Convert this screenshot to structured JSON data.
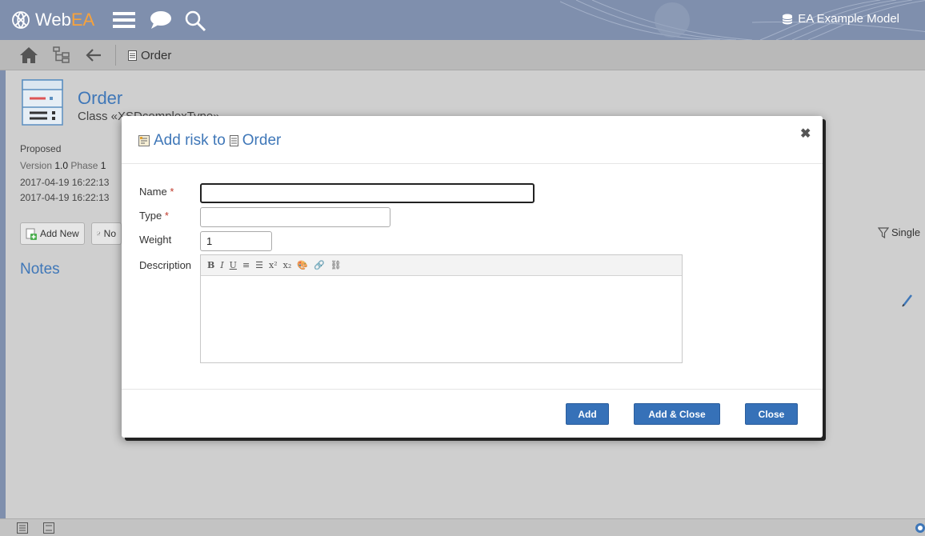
{
  "app": {
    "brand_web": "Web",
    "brand_ea": "EA",
    "model_name": "EA Example Model"
  },
  "nav": {
    "breadcrumb": "Order"
  },
  "element": {
    "title": "Order",
    "subtitle": "Class «XSDcomplexType»",
    "status": "Proposed",
    "version_label": "Version",
    "version_value": "1.0",
    "phase_label": "Phase",
    "phase_value": "1",
    "created": "2017-04-19 16:22:13",
    "modified": "2017-04-19 16:22:13"
  },
  "toolbar": {
    "add_new_label": "Add New",
    "notes_label": "No"
  },
  "page": {
    "notes_heading": "Notes",
    "filter_label": "Single"
  },
  "modal": {
    "title_prefix": "Add risk to",
    "title_target": "Order",
    "close_glyph": "✖",
    "fields": {
      "name_label": "Name",
      "name_value": "",
      "type_label": "Type",
      "type_value": "",
      "weight_label": "Weight",
      "weight_value": "1",
      "description_label": "Description",
      "required_marker": "*"
    },
    "editor_tools": [
      "B",
      "I",
      "U",
      "≡",
      "☰",
      "x²",
      "x₂",
      "🎨",
      "🔗",
      "⛓"
    ],
    "buttons": {
      "add": "Add",
      "add_close": "Add & Close",
      "close": "Close"
    }
  },
  "colors": {
    "topbar": "#7f8fad",
    "accent_blue": "#3f77b8",
    "button_blue": "#3671b8",
    "brand_orange": "#f7a23b",
    "required_red": "#c0392b"
  }
}
